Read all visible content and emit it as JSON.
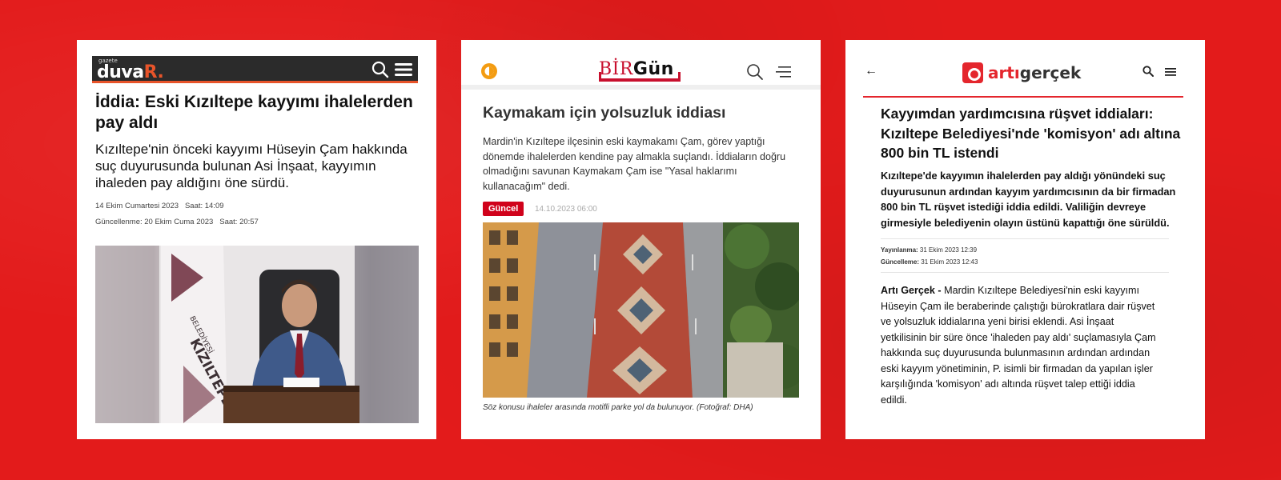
{
  "card1": {
    "logo_small": "gazete",
    "logo_word": "duva",
    "logo_r": "R.",
    "title": "İddia: Eski Kızıltepe kayyımı ihalelerden pay aldı",
    "subtitle": "Kızıltepe'nin önceki kayyımı Hüseyin Çam hakkında suç duyurusunda bulunan Asi İnşaat, kayyımın ihaleden pay aldığını öne sürdü.",
    "date": "14 Ekim Cumartesi 2023",
    "time": "Saat: 14:09",
    "updated_date": "Güncellenme: 20 Ekim Cuma 2023",
    "updated_time": "Saat: 20:57",
    "photo_text": "KIZILTEPE",
    "photo_text2": "BELEDİYESİ",
    "icons": [
      "search-icon",
      "menu-icon"
    ]
  },
  "card2": {
    "logo_bir": "BİR",
    "logo_gun": "Gün",
    "title": "Kaymakam için yolsuzluk iddiası",
    "lead": "Mardin'in Kızıltepe ilçesinin eski kaymakamı Çam, görev yaptığı dönemde ihalelerden kendine pay almakla suçlandı. İddiaların doğru olmadığını savunan Kaymakam Çam ise \"Yasal haklarımı kullanacağım\" dedi.",
    "badge": "Güncel",
    "date": "14.10.2023 06:00",
    "caption": "Söz konusu ihaleler arasında motifli parke yol da bulunuyor. (Fotoğraf: DHA)",
    "icons": [
      "theme-icon",
      "search-icon",
      "menu-icon"
    ]
  },
  "card3": {
    "back": "←",
    "logo_arti": "artı",
    "logo_gercek": "gerçek",
    "title": "Kayyımdan yardımcısına rüşvet iddiaları: Kızıltepe Belediyesi'nde 'komisyon' adı altına 800 bin TL istendi",
    "lead": "Kızıltepe'de kayyımın ihalelerden pay aldığı yönündeki suç duyurusunun ardından kayyım yardımcısının da bir firmadan 800 bin TL rüşvet istediği iddia edildi. Valiliğin devreye girmesiyle belediyenin olayın üstünü kapattığı öne sürüldü.",
    "published_label": "Yayınlanma:",
    "published_value": "31 Ekim 2023 12:39",
    "updated_label": "Güncelleme:",
    "updated_value": "31 Ekim 2023 12:43",
    "body_source": "Artı Gerçek -",
    "body_text": "Mardin Kızıltepe Belediyesi'nin eski kayyımı Hüseyin Çam ile beraberinde çalıştığı bürokratlara dair rüşvet ve yolsuzluk iddialarına yeni birisi eklendi. Asi İnşaat yetkilisinin bir süre önce 'ihaleden pay aldı' suçlamasıyla Çam hakkında suç duyurusunda bulunmasının ardından ardından eski kayyım yönetiminin, P. isimli bir firmadan da yapılan işler karşılığında 'komisyon' adı altında rüşvet talep ettiği iddia edildi.",
    "icons": [
      "search-icon",
      "menu-icon"
    ]
  },
  "colors": {
    "background": "#e31b1b",
    "duvar_accent": "#e8542a",
    "birgun_red": "#c8102e",
    "artigercek_red": "#e4262d"
  }
}
